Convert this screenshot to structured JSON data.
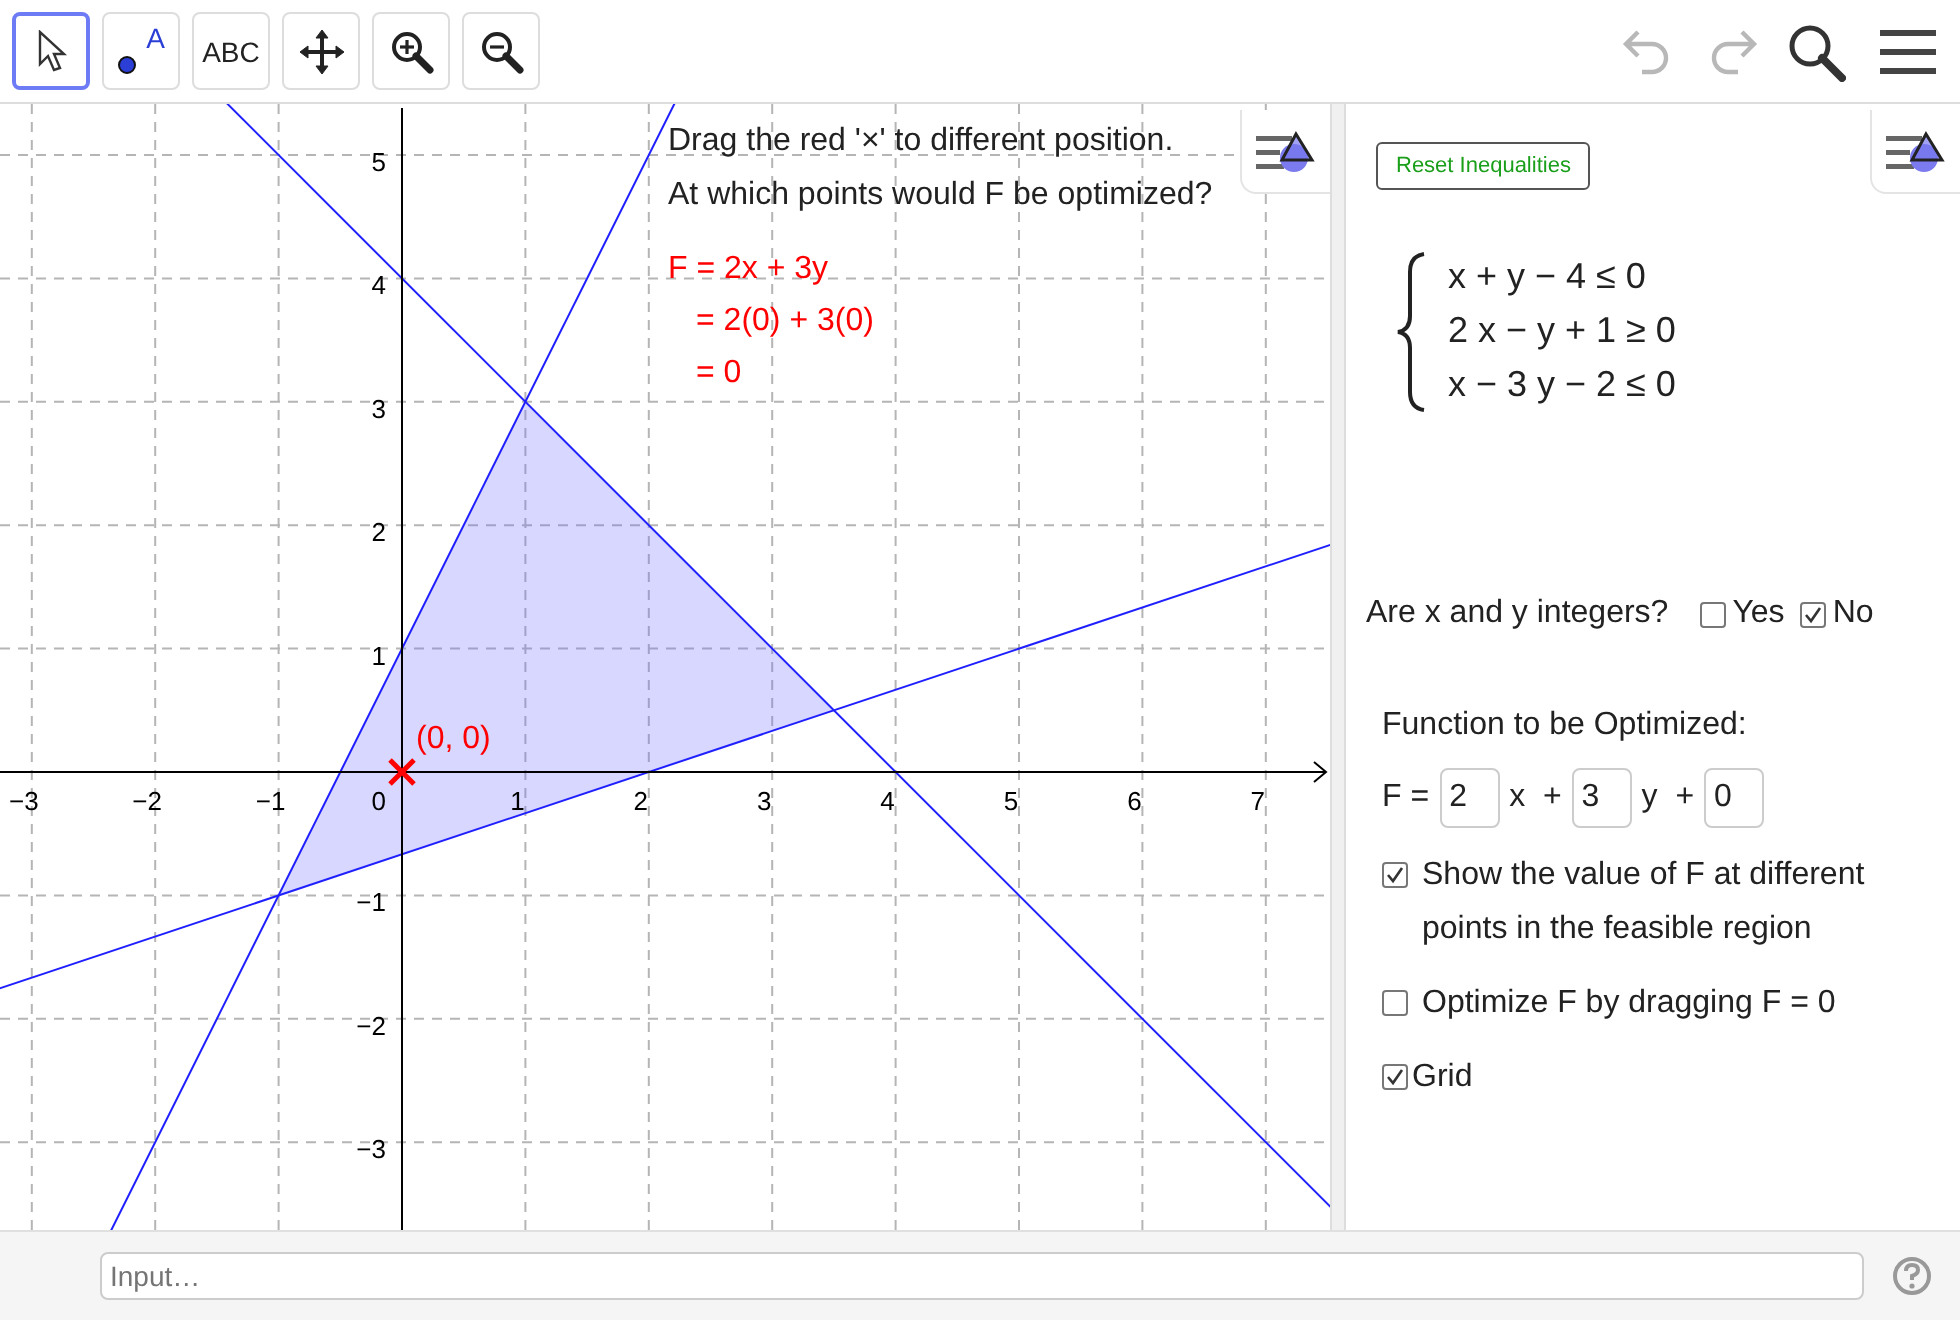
{
  "toolbar": {
    "tools": [
      {
        "kind": "move",
        "selected": true
      },
      {
        "kind": "point",
        "label": "A",
        "selected": false
      },
      {
        "kind": "text",
        "label": "ABC",
        "selected": false
      },
      {
        "kind": "pan",
        "selected": false
      },
      {
        "kind": "zoom_in",
        "selected": false
      },
      {
        "kind": "zoom_out",
        "selected": false
      }
    ],
    "history": [
      {
        "kind": "undo",
        "disabled": true
      },
      {
        "kind": "redo",
        "disabled": true
      }
    ]
  },
  "graph": {
    "instruction": [
      "Drag the red '×' to different position.",
      "At which points would F be optimized?"
    ],
    "evaluation": [
      "F = 2x + 3y",
      "= 2(0) + 3(0)",
      "= 0"
    ],
    "point_label": "(0, 0)",
    "x_tick_labels": [
      "−3",
      "−2",
      "−1",
      "1",
      "2",
      "3",
      "4",
      "5",
      "6",
      "7"
    ],
    "y_tick_labels": [
      "5",
      "4",
      "3",
      "2",
      "1",
      "−1",
      "−2",
      "−3"
    ],
    "origin_label": "0"
  },
  "panel": {
    "reset_button": "Reset Inequalities",
    "system": [
      "x + y − 4 ≤ 0",
      "2 x − y + 1 ≥ 0",
      "x − 3 y − 2 ≤ 0"
    ],
    "integers_question": "Are x and y integers?",
    "integer_options": [
      {
        "label": "Yes",
        "checked": false
      },
      {
        "label": "No",
        "checked": true
      }
    ],
    "function_title": "Function to be Optimized:",
    "function_row": [
      {
        "kind": "text",
        "text": "F ="
      },
      {
        "kind": "field",
        "value": "2"
      },
      {
        "kind": "text",
        "text": "x  +"
      },
      {
        "kind": "field",
        "value": "3"
      },
      {
        "kind": "text",
        "text": "y  +"
      },
      {
        "kind": "field",
        "value": "0"
      }
    ],
    "options": [
      {
        "kind": "show_values",
        "label": "Show the value of F at different points in the feasible region",
        "checked": true
      },
      {
        "kind": "optimize",
        "label": "Optimize F by dragging F = 0",
        "checked": false
      },
      {
        "kind": "grid",
        "label": "Grid",
        "checked": true
      }
    ]
  },
  "input_bar": {
    "placeholder": "Input…"
  }
}
